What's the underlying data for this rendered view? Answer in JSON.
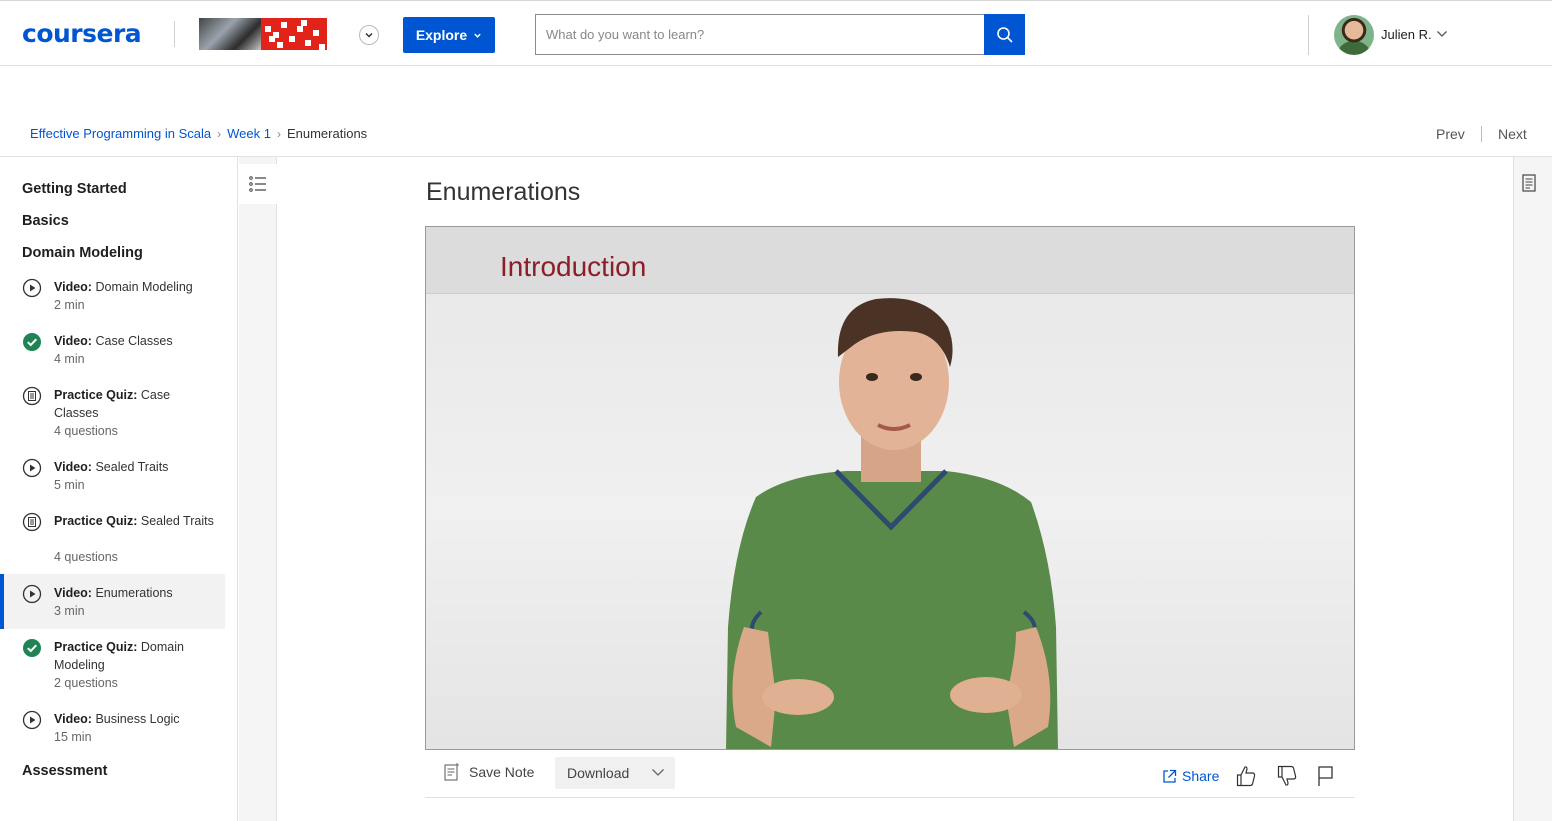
{
  "header": {
    "logo": "coursera",
    "explore_label": "Explore",
    "search_placeholder": "What do you want to learn?",
    "username": "Julien R."
  },
  "breadcrumb": {
    "course": "Effective Programming in Scala",
    "week": "Week 1",
    "current": "Enumerations",
    "prev": "Prev",
    "next": "Next"
  },
  "sidebar": {
    "sections": {
      "getting_started": "Getting Started",
      "basics": "Basics",
      "domain_modeling": "Domain Modeling",
      "assessment": "Assessment"
    },
    "items": [
      {
        "kind": "Video:",
        "title": "Domain Modeling",
        "meta": "2 min",
        "icon": "play-icon"
      },
      {
        "kind": "Video:",
        "title": "Case Classes",
        "meta": "4 min",
        "icon": "check-icon"
      },
      {
        "kind": "Practice Quiz:",
        "title": "Case Classes",
        "meta": "4 questions",
        "icon": "quiz-icon"
      },
      {
        "kind": "Video:",
        "title": "Sealed Traits",
        "meta": "5 min",
        "icon": "play-icon"
      },
      {
        "kind": "Practice Quiz:",
        "title": "Sealed Traits",
        "meta": "4 questions",
        "icon": "quiz-icon"
      },
      {
        "kind": "Video:",
        "title": "Enumerations",
        "meta": "3 min",
        "icon": "play-icon"
      },
      {
        "kind": "Practice Quiz:",
        "title": "Domain Modeling",
        "meta": "2 questions",
        "icon": "check-icon"
      },
      {
        "kind": "Video:",
        "title": "Business Logic",
        "meta": "15 min",
        "icon": "play-icon"
      }
    ]
  },
  "main": {
    "title": "Enumerations",
    "video_slide_title": "Introduction",
    "save_note": "Save Note",
    "download": "Download",
    "share": "Share"
  },
  "colors": {
    "brand": "#0056d2",
    "complete": "#1f8354",
    "slide_title": "#8a1f2a"
  }
}
